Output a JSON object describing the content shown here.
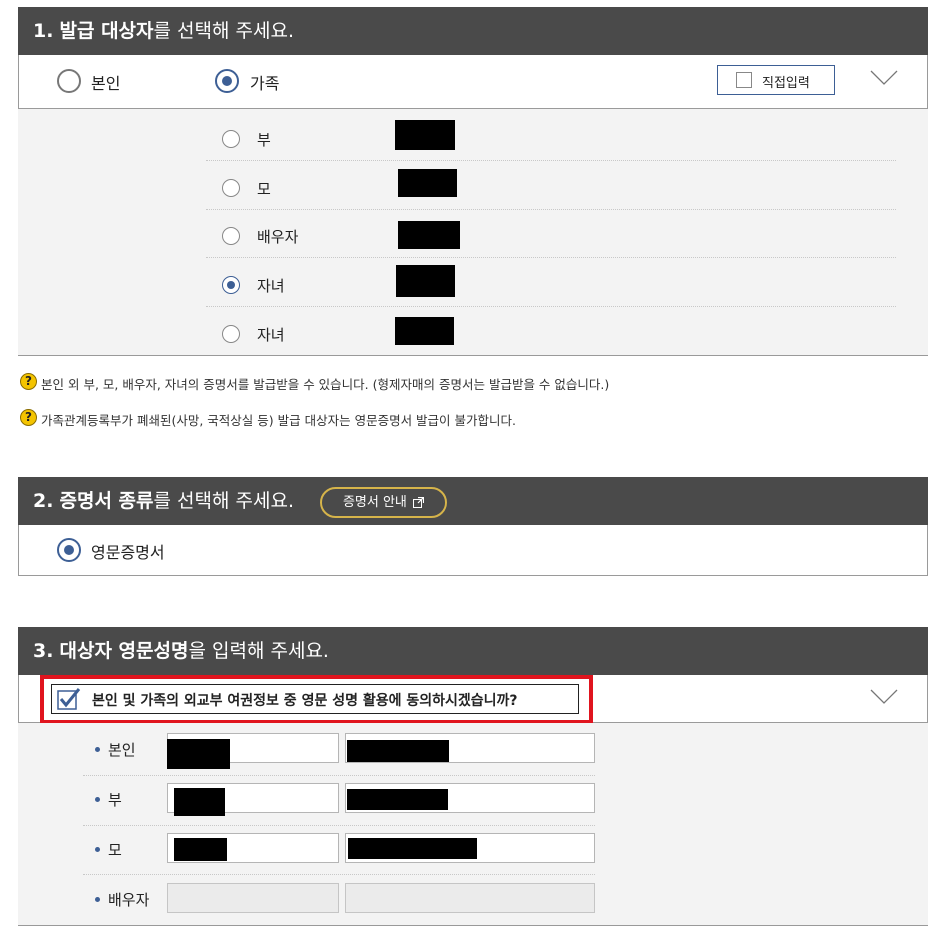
{
  "section1": {
    "number": "1.",
    "title_bold": "발급 대상자",
    "title_rest": "를 선택해 주세요.",
    "options": [
      {
        "label": "본인",
        "selected": false
      },
      {
        "label": "가족",
        "selected": true
      }
    ],
    "direct_input_label": "직접입력",
    "family": [
      {
        "label": "부",
        "selected": false
      },
      {
        "label": "모",
        "selected": false
      },
      {
        "label": "배우자",
        "selected": false
      },
      {
        "label": "자녀",
        "selected": true
      },
      {
        "label": "자녀",
        "selected": false
      }
    ],
    "help": [
      "본인 외 부, 모, 배우자, 자녀의 증명서를 발급받을 수 있습니다. (형제자매의 증명서는 발급받을 수 없습니다.)",
      "가족관계등록부가 폐쇄된(사망, 국적상실 등) 발급 대상자는 영문증명서 발급이 불가합니다."
    ],
    "help_icon": "question-icon"
  },
  "section2": {
    "number": "2.",
    "title_bold": "증명서 종류",
    "title_rest": "를 선택해 주세요.",
    "guide_button": "증명서 안내",
    "option": {
      "label": "영문증명서",
      "selected": true
    }
  },
  "section3": {
    "number": "3.",
    "title_bold": "대상자 영문성명",
    "title_rest": "을 입력해 주세요.",
    "consent_label": "본인 및 가족의 외교부 여권정보 중 영문 성명 활용에 동의하시겠습니까?",
    "consent_checked": true,
    "people": [
      "본인",
      "부",
      "모",
      "배우자"
    ]
  },
  "colors": {
    "header_bg": "#4a4a4a",
    "accent": "#3d5f95",
    "highlight_border": "#e0141e",
    "help_icon": "#f4c400"
  }
}
